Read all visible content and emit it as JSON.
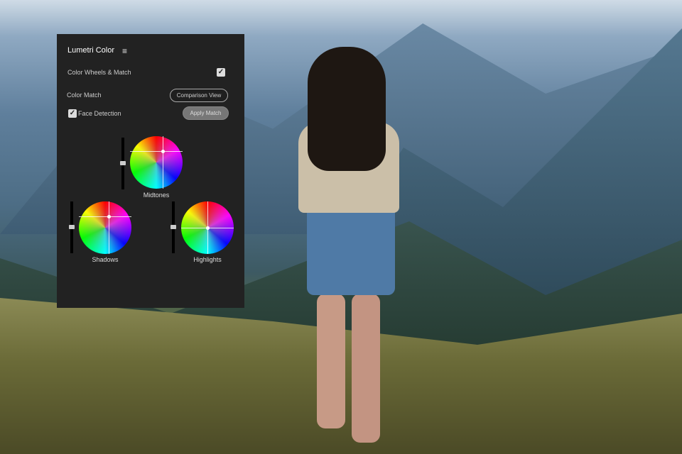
{
  "panel": {
    "title": "Lumetri Color",
    "menu_icon": "hamburger-icon",
    "section_label": "Color Wheels & Match",
    "section_checked": true,
    "color_match_label": "Color Match",
    "comparison_view": "Comparison View",
    "face_detection": "Face Detection",
    "face_detection_checked": true,
    "apply_match": "Apply Match",
    "wheels": [
      {
        "label": "Midtones"
      },
      {
        "label": "Shadows"
      },
      {
        "label": "Highlights"
      }
    ]
  }
}
